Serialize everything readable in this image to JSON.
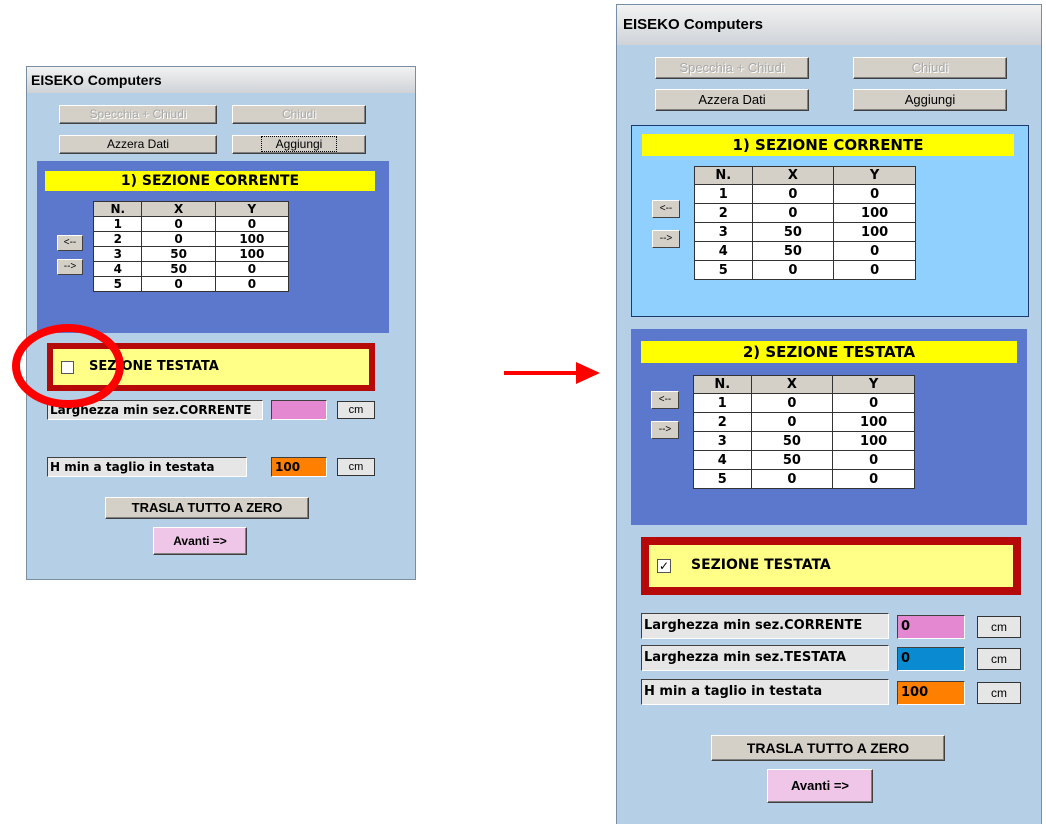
{
  "colors": {
    "window_bg": "#b4cfe6",
    "panel_blue": "#5b78cc",
    "panel_light": "#8fd0ff",
    "banner_yellow": "#ffff00",
    "red_frame": "#b60a0a",
    "pink_field": "#e488d2",
    "blue_field": "#0a8ad0",
    "orange_field": "#ff8000",
    "annotation_red": "#ff0000"
  },
  "left": {
    "title": "EISEKO Computers",
    "btn_specchia": "Specchia + Chiudi",
    "btn_chiudi": "Chiudi",
    "btn_azzera": "Azzera Dati",
    "btn_aggiungi": "Aggiungi",
    "sezione1_title": "1) SEZIONE CORRENTE",
    "arrow_left": "<--",
    "arrow_right": "-->",
    "table_headers": [
      "N.",
      "X",
      "Y"
    ],
    "rows": [
      [
        "1",
        "0",
        "0"
      ],
      [
        "2",
        "0",
        "100"
      ],
      [
        "3",
        "50",
        "100"
      ],
      [
        "4",
        "50",
        "0"
      ],
      [
        "5",
        "0",
        "0"
      ]
    ],
    "testata_label": "SEZIONE TESTATA",
    "testata_checked": false,
    "larghezza_corrente_label": "Larghezza min sez.CORRENTE",
    "larghezza_corrente_value": "",
    "unit": "cm",
    "hmin_label": "H min a taglio in testata",
    "hmin_value": "100",
    "trasla": "TRASLA TUTTO A ZERO",
    "avanti": "Avanti =>"
  },
  "right": {
    "title": "EISEKO Computers",
    "btn_specchia": "Specchia + Chiudi",
    "btn_chiudi": "Chiudi",
    "btn_azzera": "Azzera Dati",
    "btn_aggiungi": "Aggiungi",
    "sezione1_title": "1) SEZIONE CORRENTE",
    "sezione2_title": "2) SEZIONE TESTATA",
    "arrow_left": "<--",
    "arrow_right": "-->",
    "table_headers": [
      "N.",
      "X",
      "Y"
    ],
    "rows1": [
      [
        "1",
        "0",
        "0"
      ],
      [
        "2",
        "0",
        "100"
      ],
      [
        "3",
        "50",
        "100"
      ],
      [
        "4",
        "50",
        "0"
      ],
      [
        "5",
        "0",
        "0"
      ]
    ],
    "rows2": [
      [
        "1",
        "0",
        "0"
      ],
      [
        "2",
        "0",
        "100"
      ],
      [
        "3",
        "50",
        "100"
      ],
      [
        "4",
        "50",
        "0"
      ],
      [
        "5",
        "0",
        "0"
      ]
    ],
    "testata_label": "SEZIONE TESTATA",
    "testata_checked": true,
    "check_mark": "✓",
    "larghezza_corrente_label": "Larghezza min sez.CORRENTE",
    "larghezza_corrente_value": "0",
    "larghezza_testata_label": "Larghezza min sez.TESTATA",
    "larghezza_testata_value": "0",
    "unit": "cm",
    "hmin_label": "H min a taglio in testata",
    "hmin_value": "100",
    "trasla": "TRASLA TUTTO A ZERO",
    "avanti": "Avanti =>"
  }
}
